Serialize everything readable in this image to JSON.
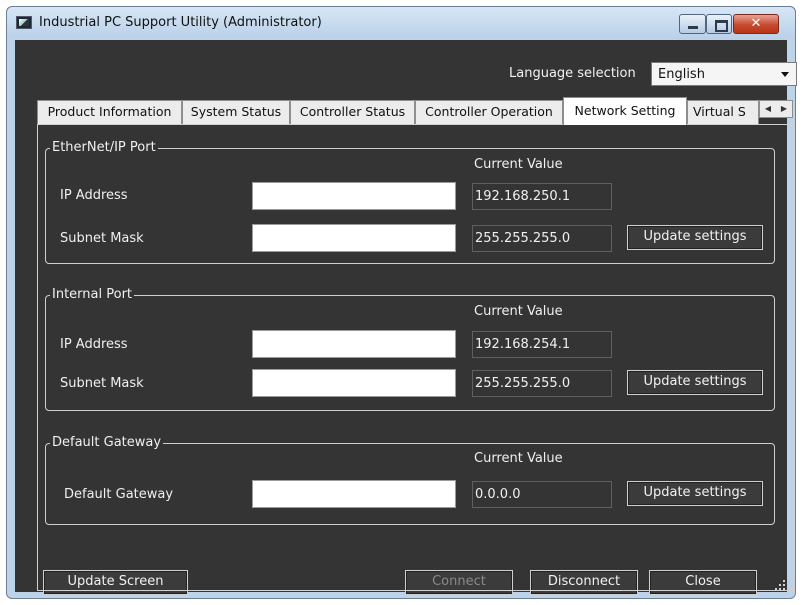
{
  "window": {
    "title": "Industrial PC Support Utility (Administrator)",
    "controls": {
      "close_symbol": "✕"
    }
  },
  "language": {
    "label": "Language selection",
    "selected": "English"
  },
  "tabs": [
    {
      "label": "Product Information"
    },
    {
      "label": "System Status"
    },
    {
      "label": "Controller Status"
    },
    {
      "label": "Controller Operation"
    },
    {
      "label": "Network Setting",
      "active": true
    },
    {
      "label": "Virtual S"
    }
  ],
  "tab_scroll": {
    "left": "◀",
    "right": "▶"
  },
  "groups": {
    "ethernet": {
      "title": "EtherNet/IP Port",
      "current_value_label": "Current Value",
      "ip_label": "IP Address",
      "ip_input": "",
      "ip_current": "192.168.250.1",
      "subnet_label": "Subnet Mask",
      "subnet_input": "",
      "subnet_current": "255.255.255.0",
      "update_label": "Update settings"
    },
    "internal": {
      "title": "Internal  Port",
      "current_value_label": "Current Value",
      "ip_label": "IP Address",
      "ip_input": "",
      "ip_current": "192.168.254.1",
      "subnet_label": "Subnet Mask",
      "subnet_input": "",
      "subnet_current": "255.255.255.0",
      "update_label": "Update settings"
    },
    "gateway": {
      "title": "Default Gateway",
      "current_value_label": "Current Value",
      "gw_label": "Default Gateway",
      "gw_input": "",
      "gw_current": "0.0.0.0",
      "update_label": "Update settings"
    }
  },
  "footer": {
    "update_screen": "Update Screen",
    "connect": "Connect",
    "disconnect": "Disconnect",
    "close": "Close"
  },
  "colors": {
    "background": "#343434",
    "titlebar": "#bcd3ea",
    "close_button": "#c64a2f"
  }
}
